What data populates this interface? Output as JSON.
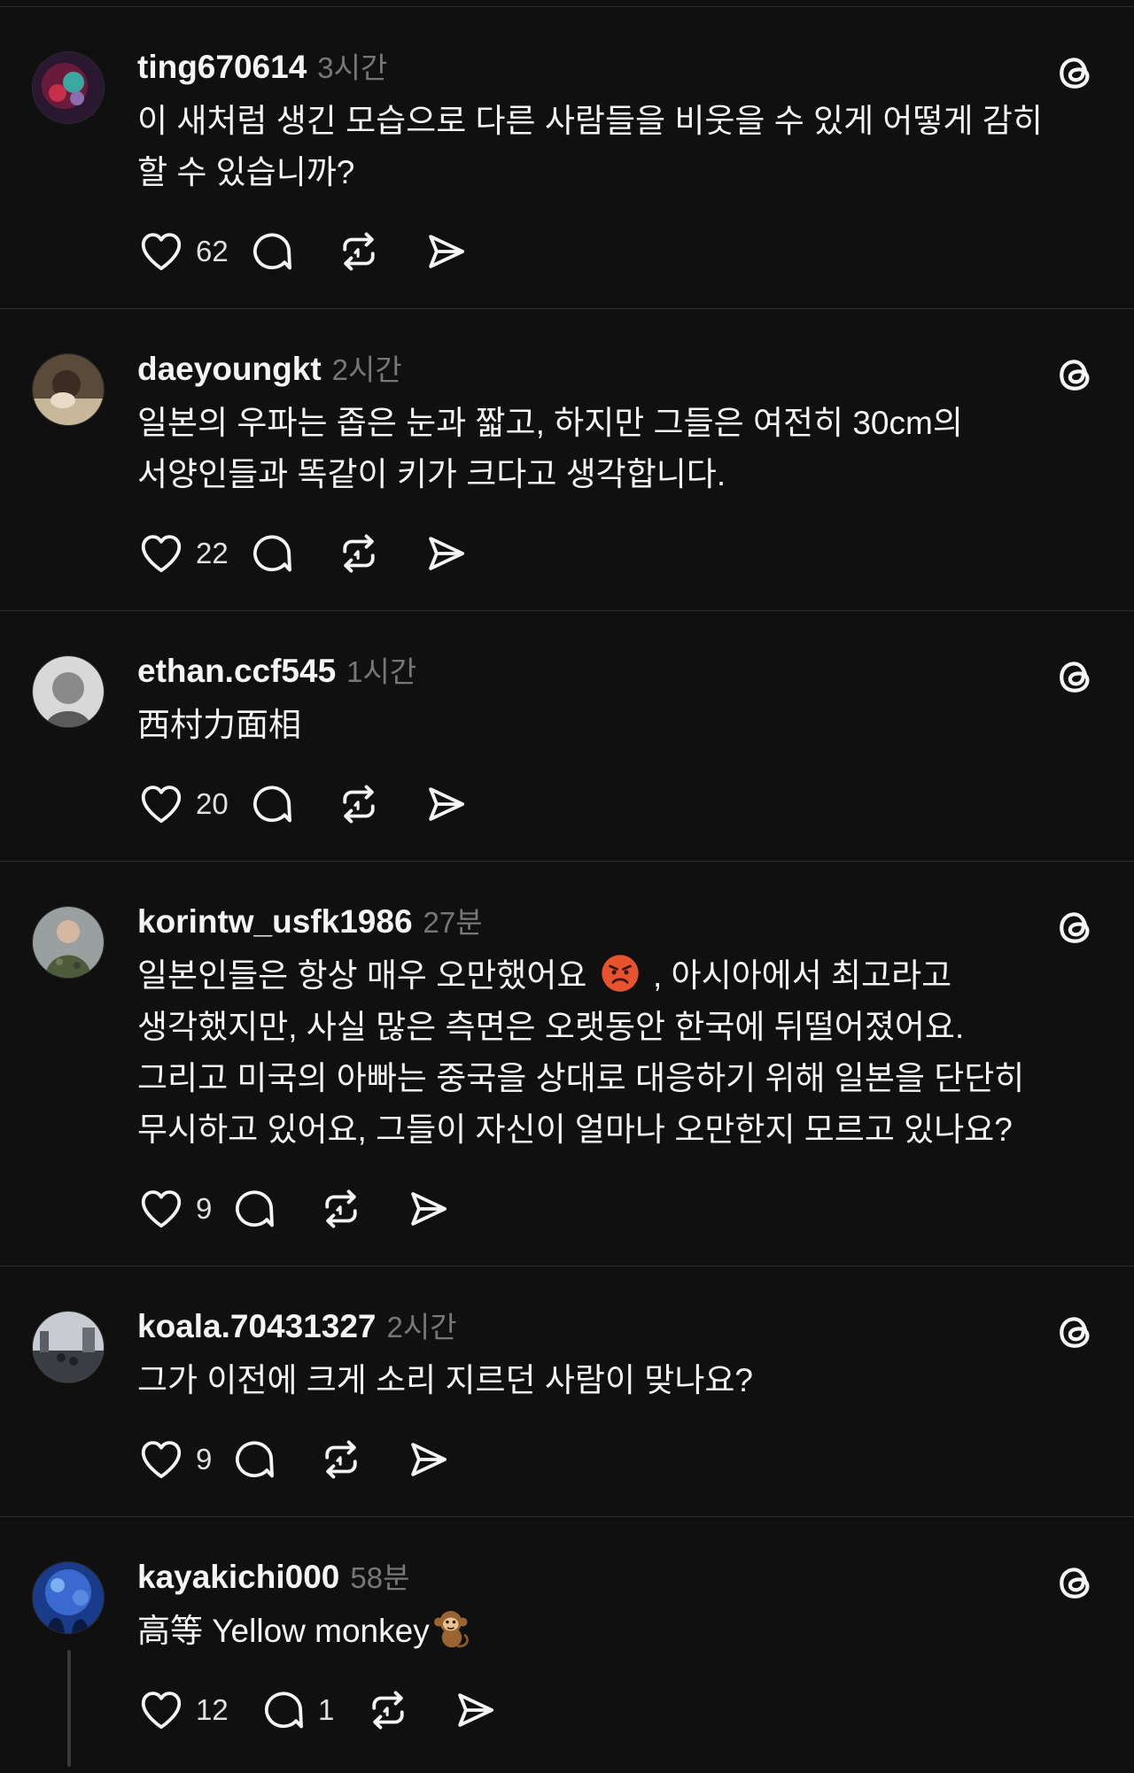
{
  "posts": [
    {
      "username": "ting670614",
      "time": "3시간",
      "text": "이 새처럼 생긴 모습으로 다른 사람들을 비웃을 수 있게 어떻게 감히 할 수 있습니까?",
      "likes": "62",
      "replies": ""
    },
    {
      "username": "daeyoungkt",
      "time": "2시간",
      "text": "일본의 우파는 좁은 눈과 짧고, 하지만 그들은 여전히 30cm의 서양인들과 똑같이 키가 크다고 생각합니다.",
      "likes": "22",
      "replies": ""
    },
    {
      "username": "ethan.ccf545",
      "time": "1시간",
      "text": "西村力面相",
      "likes": "20",
      "replies": ""
    },
    {
      "username": "korintw_usfk1986",
      "time": "27분",
      "text_before_emoji": "일본인들은 항상 매우 오만했어요",
      "text_after_emoji": ", 아시아에서 최고라고 생각했지만, 사실 많은 측면은 오랫동안 한국에 뒤떨어졌어요. 그리고 미국의 아빠는 중국을 상대로 대응하기 위해 일본을 단단히 무시하고 있어요, 그들이 자신이 얼마나 오만한지 모르고 있나요?",
      "likes": "9",
      "replies": ""
    },
    {
      "username": "koala.70431327",
      "time": "2시간",
      "text": "그가 이전에 크게 소리 지르던 사람이 맞나요?",
      "likes": "9",
      "replies": ""
    },
    {
      "username": "kayakichi000",
      "time": "58분",
      "text": "高等 Yellow monkey",
      "likes": "12",
      "replies": "1"
    }
  ],
  "icons": {
    "like": "heart-icon",
    "reply": "comment-bubble-icon",
    "repost": "repost-icon",
    "share": "send-icon",
    "brand": "threads-logo-icon"
  },
  "colors": {
    "background": "#101010",
    "text": "#f3f5f7",
    "muted": "#777777",
    "divider": "#2e2e2e"
  }
}
